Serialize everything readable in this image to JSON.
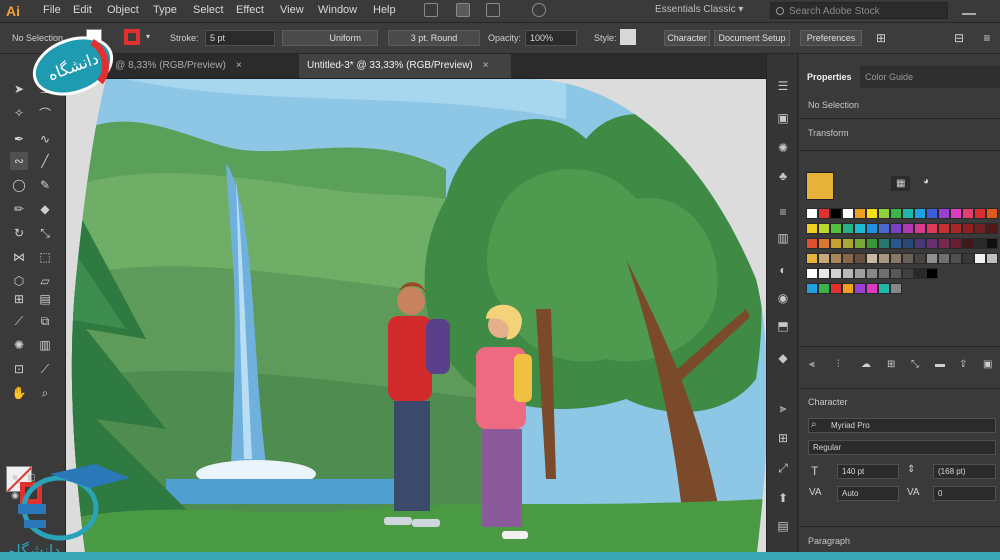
{
  "app": {
    "logo": "Ai",
    "brand_color": "#f0a232"
  },
  "menu": [
    "File",
    "Edit",
    "Object",
    "Type",
    "Select",
    "Effect",
    "View",
    "Window",
    "Help"
  ],
  "workspace": {
    "label": "Essentials Classic",
    "chevron": "▾"
  },
  "search": {
    "placeholder": "Search Adobe Stock"
  },
  "control_bar": {
    "selection_label": "No Selection",
    "stroke_label": "Stroke:",
    "stroke_value": "5 pt",
    "uniform_label": "Uniform",
    "brush_label": "3 pt. Round",
    "opacity_label": "Opacity:",
    "opacity_value": "100%",
    "style_label": "Style:",
    "character_button": "Character",
    "document_setup_button": "Document Setup",
    "preferences_button": "Preferences",
    "stroke_color": "#e03030"
  },
  "tabs": [
    {
      "label": "posts.ai* @ 8,33% (RGB/Preview)",
      "active": false
    },
    {
      "label": "Untitled-3* @ 33,33% (RGB/Preview)",
      "active": true
    }
  ],
  "tab_close_glyph": "×",
  "tools": [
    "selection-icon",
    "direct-selection-icon",
    "magic-wand-icon",
    "lasso-icon",
    "pen-icon",
    "curvature-icon",
    "line-icon",
    "paintbrush-icon",
    "ellipse-icon",
    "shaper-icon",
    "pencil-icon",
    "eraser-icon",
    "rotate-icon",
    "scale-icon",
    "width-icon",
    "free-transform-icon",
    "shape-builder-icon",
    "perspective-icon",
    "mesh-icon",
    "gradient-icon",
    "eyedropper-icon",
    "blend-icon",
    "symbol-sprayer-icon",
    "column-graph-icon",
    "hand-icon",
    "zoom-icon"
  ],
  "panel": {
    "tabs": [
      {
        "label": "Properties",
        "active": true
      },
      {
        "label": "Color Guide",
        "active": false
      }
    ],
    "no_selection": "No Selection",
    "transform_label": "Transform",
    "fill_color": "#e6b23a",
    "swatch_rows": [
      [
        "#ffffff",
        "#e03030",
        "#000000",
        "#ffffff",
        "#f0a020",
        "#f5e21a",
        "#8fd13a",
        "#3ab54a",
        "#1fb8a8",
        "#20a0e0",
        "#3f5bd8",
        "#9b3fd0",
        "#e03ac0",
        "#e04070",
        "#d83030",
        "#e05a20"
      ],
      [
        "#f0d020",
        "#b8d82a",
        "#52c040",
        "#28b088",
        "#20b8d0",
        "#2090e0",
        "#4a6ad0",
        "#7a40c8",
        "#b03ab0",
        "#d83a90",
        "#e03a5a",
        "#c83030",
        "#a82828",
        "#902020",
        "#702020",
        "#501818"
      ],
      [
        "#e05030",
        "#d87830",
        "#c8a030",
        "#a8a838",
        "#78a838",
        "#389838",
        "#287870",
        "#285890",
        "#284878",
        "#483878",
        "#683070",
        "#782850",
        "#682030",
        "#401818",
        "#2a2a2a",
        "#101010"
      ],
      [
        "#e6b23a",
        "#c8a878",
        "#a88858",
        "#886848",
        "#685040",
        "#c8b8a0",
        "#a89880",
        "#887868",
        "#686058",
        "#484440",
        "#909090",
        "#707070",
        "#505050",
        "#383838",
        "#f0f0f0",
        "#c0c0c0"
      ],
      [
        "#ffffff",
        "#e8e8e8",
        "#d0d0d0",
        "#b8b8b8",
        "#a0a0a0",
        "#888888",
        "#707070",
        "#585858",
        "#404040",
        "#282828",
        "#000000"
      ],
      [
        "#20a0e0",
        "#3ab54a",
        "#e03030",
        "#f0a020",
        "#9b3fd0",
        "#e03ac0",
        "#1fb8a8",
        "#888888"
      ]
    ],
    "character_label": "Character",
    "font_family": "Myriad Pro",
    "font_style": "Regular",
    "font_size": "140 pt",
    "leading": "(168 pt)",
    "kerning": "Auto",
    "tracking": "0",
    "paragraph_label": "Paragraph"
  },
  "watermark": {
    "text": "دانشگاه",
    "color": "#2aa3b8"
  }
}
